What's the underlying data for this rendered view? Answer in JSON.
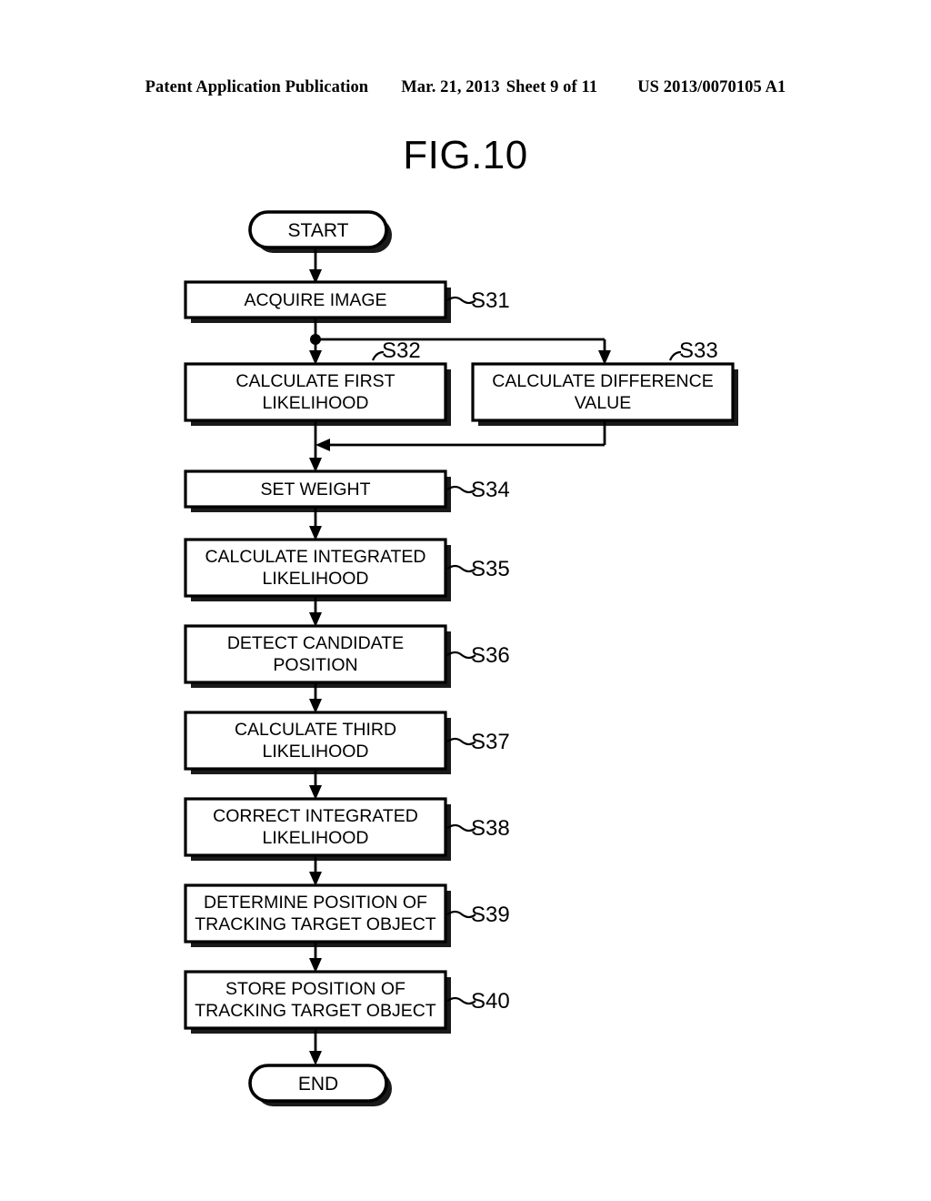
{
  "header": {
    "publication": "Patent Application Publication",
    "date": "Mar. 21, 2013",
    "sheet": "Sheet 9 of 11",
    "patent_number": "US 2013/0070105 A1"
  },
  "figure": {
    "title": "FIG.10"
  },
  "chart_data": {
    "type": "diagram",
    "diagram_kind": "flowchart",
    "title": "FIG.10",
    "nodes": [
      {
        "id": "start",
        "shape": "terminator",
        "label": "START",
        "ref": ""
      },
      {
        "id": "s31",
        "shape": "process",
        "label": "ACQUIRE IMAGE",
        "ref": "S31"
      },
      {
        "id": "s32",
        "shape": "process",
        "label": "CALCULATE FIRST\nLIKELIHOOD",
        "ref": "S32"
      },
      {
        "id": "s33",
        "shape": "process",
        "label": "CALCULATE DIFFERENCE\nVALUE",
        "ref": "S33"
      },
      {
        "id": "s34",
        "shape": "process",
        "label": "SET WEIGHT",
        "ref": "S34"
      },
      {
        "id": "s35",
        "shape": "process",
        "label": "CALCULATE INTEGRATED\nLIKELIHOOD",
        "ref": "S35"
      },
      {
        "id": "s36",
        "shape": "process",
        "label": "DETECT CANDIDATE\nPOSITION",
        "ref": "S36"
      },
      {
        "id": "s37",
        "shape": "process",
        "label": "CALCULATE THIRD\nLIKELIHOOD",
        "ref": "S37"
      },
      {
        "id": "s38",
        "shape": "process",
        "label": "CORRECT INTEGRATED\nLIKELIHOOD",
        "ref": "S38"
      },
      {
        "id": "s39",
        "shape": "process",
        "label": "DETERMINE POSITION OF\nTRACKING TARGET OBJECT",
        "ref": "S39"
      },
      {
        "id": "s40",
        "shape": "process",
        "label": "STORE POSITION OF\nTRACKING TARGET OBJECT",
        "ref": "S40"
      },
      {
        "id": "end",
        "shape": "terminator",
        "label": "END",
        "ref": ""
      }
    ],
    "edges": [
      {
        "from": "start",
        "to": "s31"
      },
      {
        "from": "s31",
        "to": "s32"
      },
      {
        "from": "s31",
        "to": "s33",
        "via": "branch-right"
      },
      {
        "from": "s33",
        "to": "s34",
        "via": "merge-left"
      },
      {
        "from": "s32",
        "to": "s34"
      },
      {
        "from": "s34",
        "to": "s35"
      },
      {
        "from": "s35",
        "to": "s36"
      },
      {
        "from": "s36",
        "to": "s37"
      },
      {
        "from": "s37",
        "to": "s38"
      },
      {
        "from": "s38",
        "to": "s39"
      },
      {
        "from": "s39",
        "to": "s40"
      },
      {
        "from": "s40",
        "to": "end"
      }
    ],
    "labels": {
      "start": "START",
      "end": "END",
      "s31": "ACQUIRE IMAGE",
      "s32_line1": "CALCULATE FIRST",
      "s32_line2": "LIKELIHOOD",
      "s33_line1": "CALCULATE DIFFERENCE",
      "s33_line2": "VALUE",
      "s34": "SET WEIGHT",
      "s35_line1": "CALCULATE INTEGRATED",
      "s35_line2": "LIKELIHOOD",
      "s36_line1": "DETECT CANDIDATE",
      "s36_line2": "POSITION",
      "s37_line1": "CALCULATE THIRD",
      "s37_line2": "LIKELIHOOD",
      "s38_line1": "CORRECT INTEGRATED",
      "s38_line2": "LIKELIHOOD",
      "s39_line1": "DETERMINE POSITION OF",
      "s39_line2": "TRACKING TARGET OBJECT",
      "s40_line1": "STORE POSITION OF",
      "s40_line2": "TRACKING TARGET OBJECT"
    },
    "refs": {
      "s31": "S31",
      "s32": "S32",
      "s33": "S33",
      "s34": "S34",
      "s35": "S35",
      "s36": "S36",
      "s37": "S37",
      "s38": "S38",
      "s39": "S39",
      "s40": "S40"
    },
    "colors": {
      "ink": "#000000",
      "paper": "#ffffff",
      "shadow": "#1a1a1a"
    }
  }
}
